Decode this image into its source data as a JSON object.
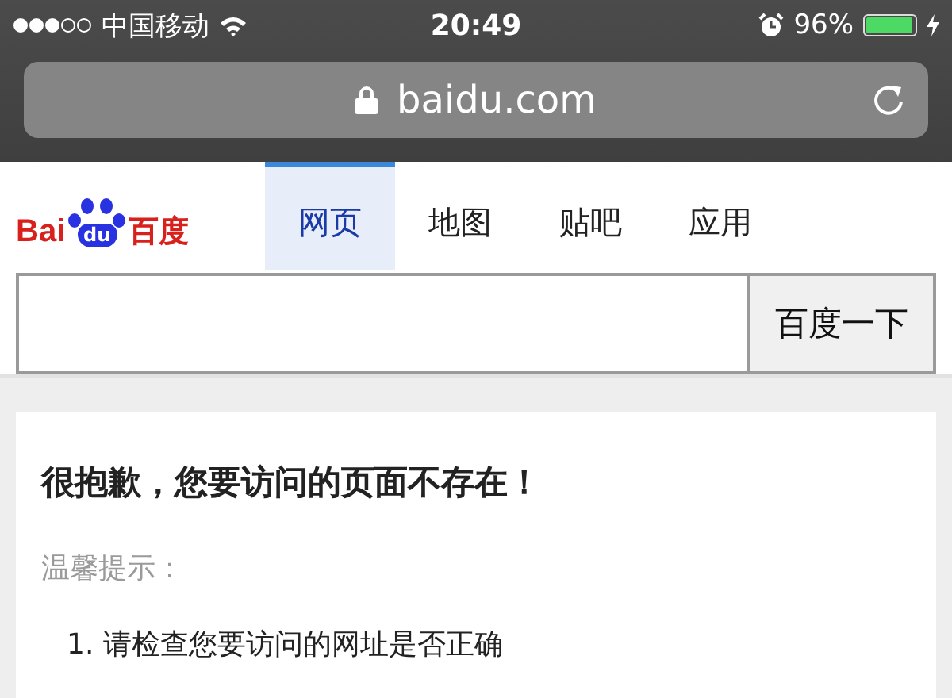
{
  "status_bar": {
    "carrier": "中国移动",
    "time": "20:49",
    "battery": "96%"
  },
  "address_bar": {
    "url": "baidu.com"
  },
  "logo": {
    "part_1": "Bai",
    "part_2": "du",
    "part_3": "百度"
  },
  "tabs": [
    {
      "label": "网页",
      "selected": true
    },
    {
      "label": "地图",
      "selected": false
    },
    {
      "label": "贴吧",
      "selected": false
    },
    {
      "label": "应用",
      "selected": false
    }
  ],
  "search": {
    "button": "百度一下"
  },
  "message": {
    "title": "很抱歉，您要访问的页面不存在！",
    "hint": "温馨提示：",
    "items": [
      "1. 请检查您要访问的网址是否正确"
    ]
  }
}
